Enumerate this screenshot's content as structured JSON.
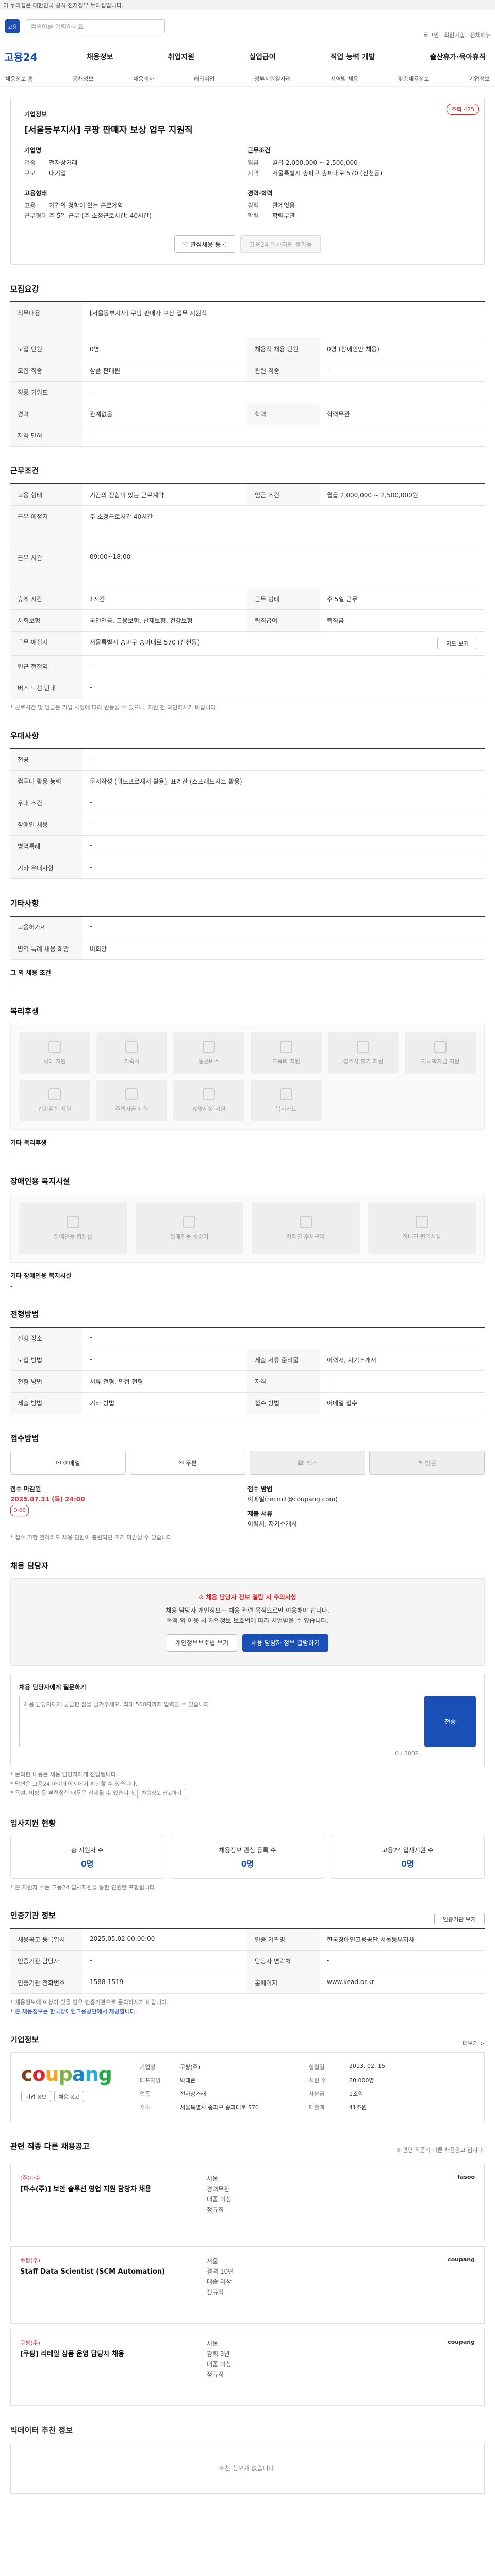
{
  "topbar": {
    "notice": "이 누리집은 대한민국 공식 전자정부 누리집입니다."
  },
  "search": {
    "placeholder": "검색어를 입력하세요",
    "logo_text": "고용"
  },
  "util": [
    "로그인",
    "회원가입",
    "전체메뉴"
  ],
  "brand": "고용24",
  "gnb": [
    "채용정보",
    "취업지원",
    "실업급여",
    "직업 능력 개발",
    "출산휴가·육아휴직"
  ],
  "subnav": [
    "채용정보 홈",
    "공채정보",
    "채용행사",
    "해외취업",
    "정부지원일자리",
    "지역별 채용",
    "맞춤채용정보",
    "기업정보"
  ],
  "job": {
    "company_label": "기업정보",
    "title": "[서울동부지사] 쿠팡 판매자 보상 업무 지원직",
    "view_count": "조회 425",
    "company_name_label": "기업명",
    "company_name": "쿠팡(주)",
    "left_k": [
      "업종",
      "규모"
    ],
    "left_v": [
      "전자상거래",
      "대기업"
    ],
    "cond_title": "근무조건",
    "cond_k": [
      "임금",
      "지역"
    ],
    "cond_v": [
      "월급 2,000,000 ~ 2,500,000",
      "서울특별시 송파구 송파대로 570 (신천동)"
    ],
    "emp_title": "고용형태",
    "emp_k": [
      "고용",
      "근무형태"
    ],
    "emp_v": [
      "기간의 정함이 있는 근로계약",
      "주 5일 근무 (주 소정근로시간: 40시간)"
    ],
    "exp_title": "경력·학력",
    "exp_k": [
      "경력",
      "학력"
    ],
    "exp_v": [
      "관계없음",
      "학력무관"
    ],
    "btn_interest": "관심채용 등록",
    "btn_apply": "고용24 입사지원 불가능"
  },
  "sections": {
    "recruit": {
      "title": "모집요강",
      "job_head": "직무내용",
      "job_body": "[서울동부지사] 쿠팡 판매자 보상 업무 지원직",
      "rows": [
        [
          "모집 인원",
          "0명",
          "채용직 채용 인원",
          "0명 (장애인만 채용)"
        ],
        [
          "모집 직종",
          "상품 판매원",
          "관련 직종",
          "-"
        ],
        [
          "직종 키워드",
          "-",
          "",
          ""
        ],
        [
          "경력",
          "관계없음",
          "학력",
          "학력무관"
        ],
        [
          "자격 면허",
          "-",
          "",
          ""
        ]
      ]
    },
    "work": {
      "title": "근무조건",
      "rows": [
        [
          "고용 형태",
          "기간의 정함이 있는 근로계약",
          "임금 조건",
          "월급 2,000,000 ~ 2,500,000원"
        ],
        [
          "근무 예정지",
          "",
          "",
          ""
        ],
        [
          "근무 시간",
          "09:00~18:00",
          "",
          ""
        ],
        [
          "휴게 시간",
          "1시간",
          "근무 형태",
          "주 5일 근무"
        ],
        [
          "사회보험",
          "국민연금, 고용보험, 산재보험, 건강보험",
          "퇴직급여",
          "퇴직금"
        ],
        [
          "근무 예정지",
          "서울특별시 송파구 송파대로 570 (신천동)",
          "",
          ""
        ],
        [
          "인근 전철역",
          "-",
          "",
          ""
        ],
        [
          "버스 노선 안내",
          "-",
          "",
          ""
        ]
      ],
      "area": "주 소정근로시간 40시간",
      "map_btn": "지도 보기",
      "note": "* 근로시간 및 임금은 기업 사정에 따라 변동될 수 있으니, 지원 전 확인하시기 바랍니다."
    },
    "prefer": {
      "title": "우대사항",
      "rows": [
        [
          "전공",
          "-"
        ],
        [
          "컴퓨터 활용 능력",
          "문서작성 (워드프로세서 활용), 표계산 (스프레드시트 활용)"
        ],
        [
          "우대 조건",
          "-"
        ],
        [
          "장애인 채용",
          "-"
        ],
        [
          "병역특례",
          "-"
        ],
        [
          "기타 우대사항",
          "-"
        ]
      ]
    },
    "etc": {
      "title": "기타사항",
      "rows": [
        [
          "고용허가제",
          "-"
        ],
        [
          "병역 특례 채용 희망",
          "비희망"
        ]
      ],
      "more_head": "그 외 채용 조건",
      "more_body": "-"
    },
    "welfare": {
      "title": "복리후생",
      "tiles": [
        "식대 지원",
        "기숙사",
        "통근버스",
        "교육비 지원",
        "경조사 휴가 지원",
        "자녀학자금 지원",
        "건강검진 지원",
        "주택자금 지원",
        "휴양시설 지원",
        "복지카드"
      ],
      "other_head": "기타 복리후생",
      "other_body": "-"
    },
    "disability": {
      "title": "장애인용 복지시설",
      "tiles": [
        "장애인용 화장실",
        "장애인용 승강기",
        "장애인 주차구역",
        "장애인 편의시설"
      ],
      "other_head": "기타 장애인용 복지시설",
      "other_body": "-"
    },
    "method": {
      "title": "전형방법",
      "rows": [
        [
          "전형 장소",
          "-",
          "",
          ""
        ],
        [
          "모집 방법",
          "-",
          "제출 서류 준비물",
          "이력서, 자기소개서"
        ],
        [
          "전형 방법",
          "서류 전형, 면접 전형",
          "자격",
          "-"
        ],
        [
          "제출 방법",
          "기타 방법",
          "접수 방법",
          "이메일 접수"
        ]
      ]
    },
    "apply": {
      "title": "접수방법",
      "btns": [
        "이메일",
        "우편",
        "팩스",
        "방문"
      ],
      "deadline_label": "접수 마감일",
      "deadline": "2025.07.31 (목) 24:00",
      "dday": "D-90",
      "method_label": "접수 방법",
      "method": "이메일(recruit@coupang.com)",
      "form_label": "제출 서류",
      "form": "이력서, 자기소개서",
      "note": "* 접수 기한 전이라도 채용 인원이 충원되면 조기 마감될 수 있습니다."
    },
    "manager": {
      "title": "채용 담당자",
      "warn": "채용 담당자 정보 열람 시 주의사항",
      "desc1": "채용 담당자 개인정보는 채용 관련 목적으로만 이용해야 합니다.",
      "desc2": "목적 외 이용 시 개인정보 보호법에 따라 처벌받을 수 있습니다.",
      "btn1": "개인정보보호법 보기",
      "btn2": "채용 담당자 정보 열람하기",
      "inq_title": "채용 담당자에게 질문하기",
      "inq_placeholder": "채용 담당자에게 궁금한 점을 남겨주세요. 최대 500자까지 입력할 수 있습니다.",
      "send": "전송",
      "counter": "0 / 500자",
      "notes": [
        "* 문의한 내용은 채용 담당자에게 전달됩니다.",
        "* 답변은 고용24 마이페이지에서 확인할 수 있습니다.",
        "* 욕설, 비방 등 부적절한 내용은 삭제될 수 있습니다."
      ],
      "notes_btn": "채용정보 신고하기"
    },
    "stats": {
      "title": "입사지원 현황",
      "items": [
        {
          "label": "총 지원자 수",
          "value": "0명"
        },
        {
          "label": "채용정보 관심 등록 수",
          "value": "0명"
        },
        {
          "label": "고용24 입사지원 수",
          "value": "0명"
        }
      ],
      "note": "* 본 지원자 수는 고용24 입사지원을 통한 인원만 포함됩니다."
    },
    "org": {
      "title": "인증기관 정보",
      "btn": "인증기관 보기",
      "rows": [
        [
          "채용공고 등록일시",
          "2025.05.02 00:00:00",
          "인증 기관명",
          "한국장애인고용공단 서울동부지사"
        ],
        [
          "인증기관 담당자",
          "-",
          "담당자 연락처",
          "-"
        ],
        [
          "인증기관 전화번호",
          "1588-1519",
          "홈페이지",
          "www.kead.or.kr"
        ]
      ],
      "note": "* 채용정보에 이상이 있을 경우 인증기관으로 문의하시기 바랍니다.",
      "note2": "* 본 채용정보는 한국장애인고용공단에서 제공합니다."
    },
    "company": {
      "title": "기업정보",
      "more": "더보기 >",
      "logo_word": "coupang",
      "k": [
        "기업명",
        "대표자명",
        "업종",
        "주소",
        "설립일",
        "직원 수",
        "자본금",
        "매출액"
      ],
      "v": [
        "쿠팡(주)",
        "박대준",
        "전자상거래",
        "서울특별시 송파구 송파대로 570",
        "2013. 02. 15",
        "80,000명",
        "1조원",
        "41조원"
      ],
      "btn1": "기업 정보",
      "btn2": "채용 공고"
    },
    "related": {
      "title": "관련 직종 다른 채용공고",
      "note": "※ 관련 직종의 다른 채용공고 입니다.",
      "items": [
        {
          "corp": "(주)파수",
          "title": "[파수(주)] 보안 솔루션 영업 지원 담당자 채용",
          "meta": [
            "서울",
            "경력무관",
            "대졸 이상",
            "정규직"
          ],
          "logo": "fasoo"
        },
        {
          "corp": "쿠팡(주)",
          "title": "Staff Data Scientist (SCM Automation)",
          "meta": [
            "서울",
            "경력 10년",
            "대졸 이상",
            "정규직"
          ],
          "logo": "coupang"
        },
        {
          "corp": "쿠팡(주)",
          "title": "[쿠팡] 리테일 상품 운영 담당자 채용",
          "meta": [
            "서울",
            "경력 3년",
            "대졸 이상",
            "정규직"
          ],
          "logo": "coupang"
        }
      ]
    },
    "recommend": {
      "title": "빅데이터 추천 정보",
      "empty": "추천 정보가 없습니다."
    }
  }
}
